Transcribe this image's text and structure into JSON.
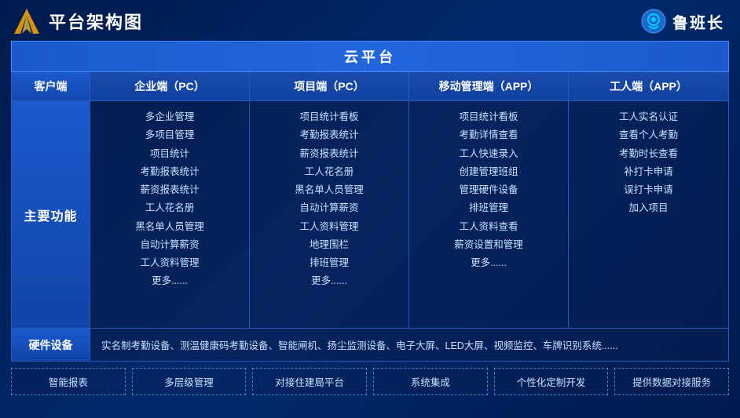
{
  "header": {
    "title": "平台架构图",
    "brand_name": "鲁班长"
  },
  "cloud_platform": {
    "label": "云平台"
  },
  "columns": {
    "client_label": "客户端",
    "enterprise_label": "企业端（PC）",
    "project_label": "项目端（PC）",
    "mobile_label": "移动管理端（APP）",
    "worker_label": "工人端（APP）"
  },
  "main_function": {
    "label": "主要功能",
    "enterprise_items": [
      "多企业管理",
      "多项目管理",
      "项目统计",
      "考勤报表统计",
      "薪资报表统计",
      "工人花名册",
      "黑名单人员管理",
      "自动计算薪资",
      "工人资料管理",
      "更多......"
    ],
    "project_items": [
      "项目统计看板",
      "考勤报表统计",
      "薪资报表统计",
      "工人花名册",
      "黑名单人员管理",
      "自动计算薪资",
      "工人资料管理",
      "地理围栏",
      "排班管理",
      "更多......"
    ],
    "mobile_items": [
      "项目统计看板",
      "考勤详情查看",
      "工人快速录入",
      "创建管理班组",
      "管理硬件设备",
      "排班管理",
      "工人资料查看",
      "薪资设置和管理",
      "更多......"
    ],
    "worker_items": [
      "工人实名认证",
      "查看个人考勤",
      "考勤时长查看",
      "补打卡申请",
      "误打卡申请",
      "加入项目"
    ]
  },
  "hardware": {
    "label": "硬件设备",
    "content": "实名制考勤设备、测温健康码考勤设备、智能闸机、扬尘监测设备、电子大屏、LED大屏、视频监控、车牌识别系统......"
  },
  "features": [
    "智能报表",
    "多层级管理",
    "对接住建局平台",
    "系统集成",
    "个性化定制开发",
    "提供数据对接服务"
  ]
}
